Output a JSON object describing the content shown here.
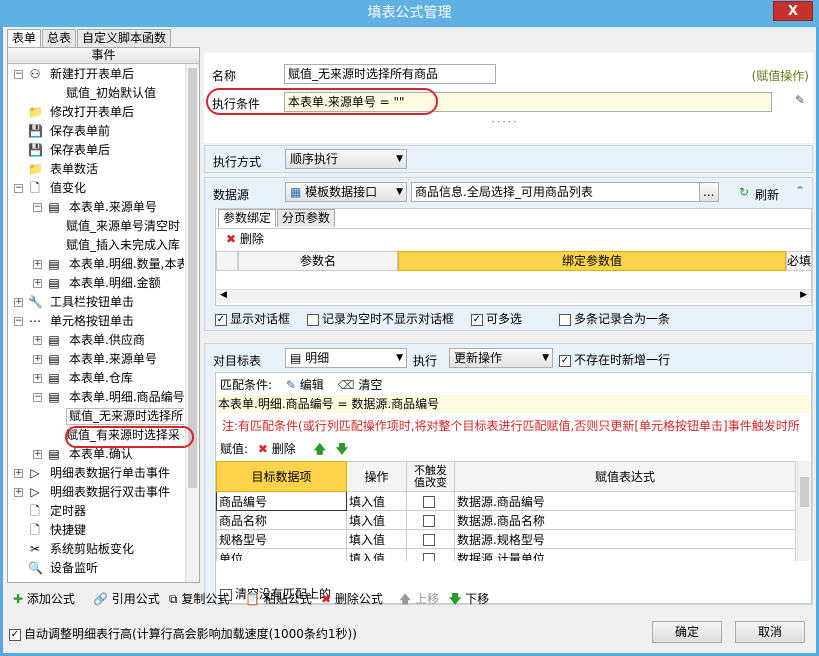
{
  "window": {
    "title": "填表公式管理",
    "close_label": "X"
  },
  "tabs": [
    {
      "label": "表单"
    },
    {
      "label": "总表"
    },
    {
      "label": "自定义脚本函数"
    }
  ],
  "left": {
    "header": "事件",
    "tree": [
      {
        "text": "新建打开表单后",
        "level": 0,
        "toggle": "−",
        "icon": "⚇"
      },
      {
        "text": "赋值_初始默认值",
        "level": 2
      },
      {
        "text": "修改打开表单后",
        "level": 0,
        "icon": "📁"
      },
      {
        "text": "保存表单前",
        "level": 0,
        "icon": "💾"
      },
      {
        "text": "保存表单后",
        "level": 0,
        "icon": "💾"
      },
      {
        "text": "表单数活",
        "level": 0,
        "icon": "📁"
      },
      {
        "text": "值变化",
        "level": 0,
        "toggle": "−",
        "icon": "🗋"
      },
      {
        "text": "本表单.来源单号",
        "level": 1,
        "toggle": "−",
        "icon": "▤"
      },
      {
        "text": "赋值_来源单号清空时",
        "level": 2
      },
      {
        "text": "赋值_插入未完成入库",
        "level": 2
      },
      {
        "text": "本表单.明细.数量,本表",
        "level": 1,
        "toggle": "+",
        "icon": "▤"
      },
      {
        "text": "本表单.明细.金额",
        "level": 1,
        "toggle": "+",
        "icon": "▤"
      },
      {
        "text": "工具栏按钮单击",
        "level": 0,
        "toggle": "+",
        "icon": "🔧"
      },
      {
        "text": "单元格按钮单击",
        "level": 0,
        "toggle": "−",
        "icon": "⋯"
      },
      {
        "text": "本表单.供应商",
        "level": 1,
        "toggle": "+",
        "icon": "▤"
      },
      {
        "text": "本表单.来源单号",
        "level": 1,
        "toggle": "+",
        "icon": "▤"
      },
      {
        "text": "本表单.仓库",
        "level": 1,
        "toggle": "+",
        "icon": "▤"
      },
      {
        "text": "本表单.明细.商品编号",
        "level": 1,
        "toggle": "−",
        "icon": "▤"
      },
      {
        "text": "赋值_无来源时选择所",
        "level": 2,
        "selected": true
      },
      {
        "text": "赋值_有来源时选择采",
        "level": 2
      },
      {
        "text": "本表单.确认",
        "level": 1,
        "toggle": "+",
        "icon": "▤"
      },
      {
        "text": "明细表数据行单击事件",
        "level": 0,
        "toggle": "+",
        "icon": "▷"
      },
      {
        "text": "明细表数据行双击事件",
        "level": 0,
        "toggle": "+",
        "icon": "▷"
      },
      {
        "text": "定时器",
        "level": 0,
        "icon": "🗋"
      },
      {
        "text": "快捷键",
        "level": 0,
        "icon": "🗋"
      },
      {
        "text": "系统剪贴板变化",
        "level": 0,
        "icon": "✂"
      },
      {
        "text": "设备监听",
        "level": 0,
        "icon": "🔍"
      }
    ]
  },
  "form": {
    "name_label": "名称",
    "name_value": "赋值_无来源时选择所有商品",
    "op_type": "(赋值操作)",
    "cond_label": "执行条件",
    "cond_value": "本表单.来源单号 = \"\"",
    "exec_label": "执行方式",
    "exec_value": "顺序执行",
    "ds_label": "数据源",
    "ds_type": "模板数据接口",
    "ds_value": "商品信息.全局选择_可用商品列表",
    "ds_more": "...",
    "refresh": "刷新",
    "subtabs": [
      {
        "label": "参数绑定"
      },
      {
        "label": "分页参数"
      }
    ],
    "delete": "删除",
    "param_cols": [
      "参数名",
      "绑定参数值",
      "必填"
    ],
    "opts": [
      {
        "label": "显示对话框",
        "checked": true
      },
      {
        "label": "记录为空时不显示对话框",
        "checked": false
      },
      {
        "label": "可多选",
        "checked": true
      },
      {
        "label": "多条记录合为一条",
        "checked": false
      }
    ],
    "target_label": "对目标表",
    "target_value": "明细",
    "exec2_label": "执行",
    "exec2_value": "更新操作",
    "add_row_label": "不存在时新增一行",
    "match_label": "匹配条件:",
    "edit": "编辑",
    "clear": "清空",
    "match_expr": "本表单.明细.商品编号 = 数据源.商品编号",
    "note": "注:有匹配条件(或行列匹配操作项时,将对整个目标表进行匹配赋值,否则只更新[单元格按钮单击]事件触发时所",
    "assign_label": "赋值:",
    "assign_delete": "删除",
    "assign_cols": [
      "目标数据项",
      "操作",
      "不触发\n值改变",
      "赋值表达式"
    ],
    "rows": [
      {
        "target": "商品编号",
        "op": "填入值",
        "expr": "数据源.商品编号"
      },
      {
        "target": "商品名称",
        "op": "填入值",
        "expr": "数据源.商品名称"
      },
      {
        "target": "规格型号",
        "op": "填入值",
        "expr": "数据源.规格型号"
      },
      {
        "target": "单位",
        "op": "填入值",
        "expr": "数据源.计量单位"
      }
    ],
    "clear_unmatched": "清空没有匹配上的"
  },
  "toolbar": {
    "add": "添加公式",
    "ref": "引用公式",
    "copy": "复制公式",
    "paste": "粘贴公式",
    "del": "删除公式",
    "up": "上移",
    "down": "下移"
  },
  "footer": {
    "auto_height": "自动调整明细表行高(计算行高会影响加载速度(1000条约1秒))",
    "ok": "确定",
    "cancel": "取消"
  }
}
